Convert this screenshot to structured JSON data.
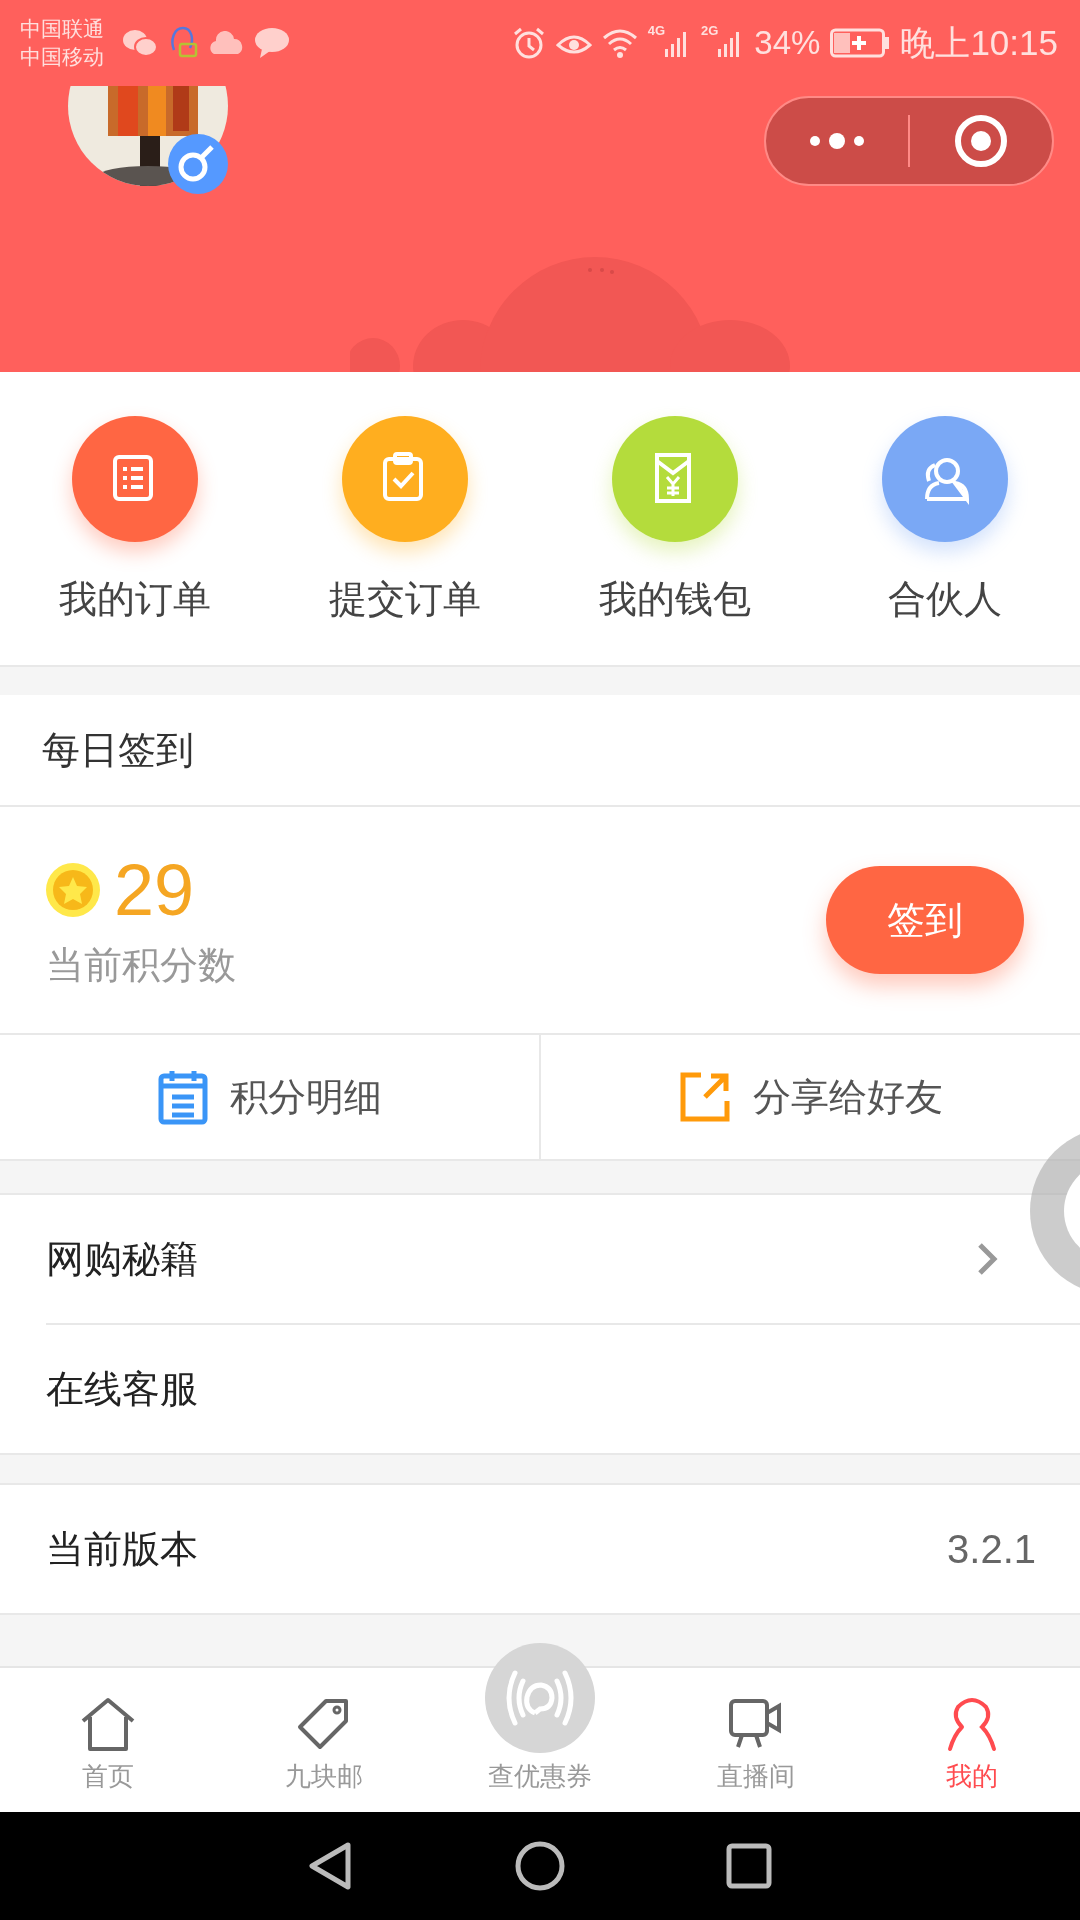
{
  "status_bar": {
    "carriers": [
      "中国联通",
      "中国移动"
    ],
    "network_4g": "4G",
    "network_2g": "2G",
    "battery": "34%",
    "time": "晚上10:15"
  },
  "profile": {
    "avatar": {
      "kind": "picture"
    }
  },
  "quick_actions": [
    {
      "label": "我的订单",
      "kind": "list",
      "color": "#ff6643"
    },
    {
      "label": "提交订单",
      "kind": "clipboard",
      "color": "#ffae1f"
    },
    {
      "label": "我的钱包",
      "kind": "wallet",
      "color": "#b4dc3c"
    },
    {
      "label": "合伙人",
      "kind": "person",
      "color": "#7aa8f5"
    }
  ],
  "checkin": {
    "title": "每日签到",
    "points": "29",
    "points_label": "当前积分数",
    "button": "签到"
  },
  "links": [
    {
      "label": "积分明细",
      "kind": "calendar"
    },
    {
      "label": "分享给好友",
      "kind": "share"
    }
  ],
  "menu_groups": [
    [
      {
        "label": "网购秘籍",
        "arrow": true
      },
      {
        "label": "在线客服",
        "arrow": false
      }
    ],
    [
      {
        "label": "当前版本",
        "value": "3.2.1",
        "arrow": false
      }
    ]
  ],
  "tab_bar": [
    {
      "label": "首页",
      "kind": "home",
      "selected": false
    },
    {
      "label": "九块邮",
      "kind": "tag",
      "selected": false
    },
    {
      "label": "查优惠券",
      "kind": "broadcast",
      "selected": false
    },
    {
      "label": "直播间",
      "kind": "camera",
      "selected": false
    },
    {
      "label": "我的",
      "kind": "user",
      "selected": true
    }
  ]
}
